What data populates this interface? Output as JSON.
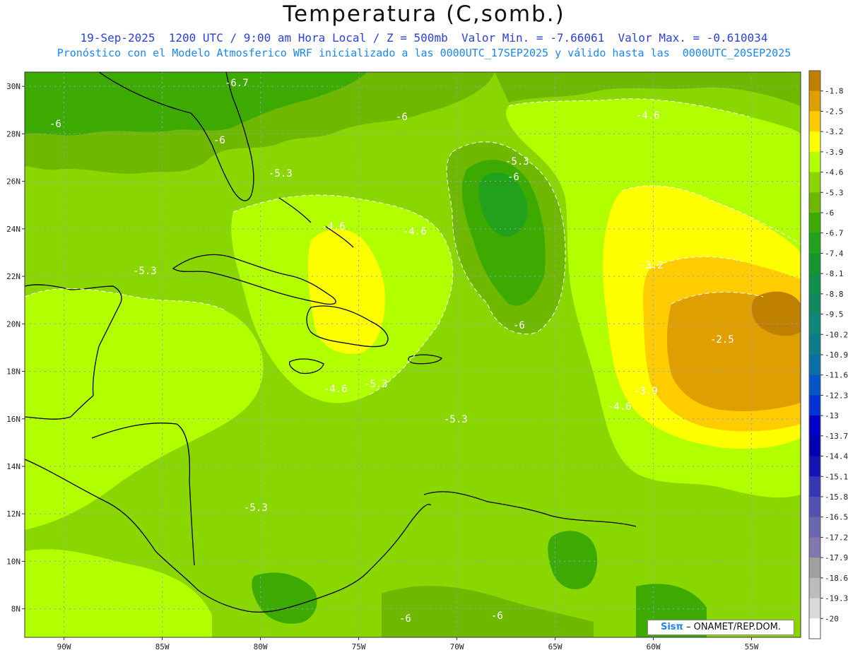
{
  "title": "Temperatura (C,somb.)",
  "subtitle1": "19-Sep-2025  1200 UTC / 9:00 am Hora Local / Z = 500mb  Valor Min. = -7.66061  Valor Max. = -0.610034",
  "subtitle2": "Pronóstico con el Modelo Atmosferico WRF inicializado a las 0000UTC_17SEP2025 y válido hasta las  0000UTC_20SEP2025",
  "credit": {
    "brand": "Sisπ",
    "text": "– ONAMET/REP.DOM."
  },
  "axes": {
    "lat_ticks": [
      "30N",
      "28N",
      "26N",
      "24N",
      "22N",
      "20N",
      "18N",
      "16N",
      "14N",
      "12N",
      "10N",
      "8N"
    ],
    "lon_ticks": [
      "90W",
      "85W",
      "80W",
      "75W",
      "70W",
      "65W",
      "60W",
      "55W"
    ]
  },
  "colorbar": {
    "labels": [
      "-1.8",
      "-2.5",
      "-3.2",
      "-3.9",
      "-4.6",
      "-5.3",
      "-6",
      "-6.7",
      "-7.4",
      "-8.1",
      "-8.8",
      "-9.5",
      "-10.2",
      "-10.9",
      "-11.6",
      "-12.3",
      "-13",
      "-13.7",
      "-14.4",
      "-15.1",
      "-15.8",
      "-16.5",
      "-17.2",
      "-17.9",
      "-18.6",
      "-19.3",
      "-20"
    ],
    "colors": [
      "#bf8000",
      "#df9f00",
      "#ffcc00",
      "#ffff00",
      "#b2ff00",
      "#8ad600",
      "#6fb800",
      "#3caa00",
      "#22a11c",
      "#15962f",
      "#0e8f4a",
      "#0f8a60",
      "#0c8779",
      "#0b7d8c",
      "#0a6fa8",
      "#0555c8",
      "#0033d6",
      "#0000c8",
      "#0000b4",
      "#1414b4",
      "#3737b5",
      "#5252b3",
      "#6a66b0",
      "#8477b0",
      "#a0a0a0",
      "#bcbcbc",
      "#dadada",
      "#ffffff"
    ]
  },
  "contour_labels": [
    {
      "text": "-6.7"
    },
    {
      "text": "-6"
    },
    {
      "text": "-6"
    },
    {
      "text": "-6"
    },
    {
      "text": "-4.6"
    },
    {
      "text": "-5.3"
    },
    {
      "text": "-6"
    },
    {
      "text": "-5.3"
    },
    {
      "text": "-4.6"
    },
    {
      "text": "-4.6"
    },
    {
      "text": "-5.3"
    },
    {
      "text": "-3.2"
    },
    {
      "text": "-6"
    },
    {
      "text": "-2.5"
    },
    {
      "text": "-4.6"
    },
    {
      "text": "-5.3"
    },
    {
      "text": "-3.9"
    },
    {
      "text": "-4.6"
    },
    {
      "text": "-5.3"
    },
    {
      "text": "-5.3"
    },
    {
      "text": "-6"
    },
    {
      "text": "-6"
    }
  ]
}
